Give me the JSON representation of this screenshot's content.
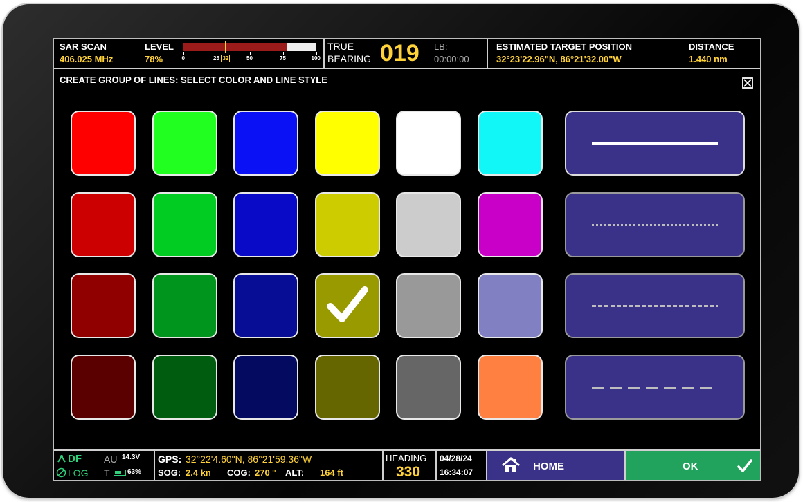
{
  "header": {
    "sar_label": "SAR SCAN",
    "sar_freq": "406.025 MHz",
    "level_label": "LEVEL",
    "level_value_text": "78%",
    "level_fraction": 0.78,
    "level_marker_value": 32,
    "level_ticks": [
      "0",
      "25",
      "32",
      "50",
      "75",
      "100"
    ],
    "bearing_label_top": "TRUE",
    "bearing_label_bottom": "BEARING",
    "bearing_value": "019",
    "lb_label": "LB:",
    "lb_time": "00:00:00",
    "target_label": "ESTIMATED TARGET POSITION",
    "target_value": "32°23'22.96\"N,  86°21'32.00\"W",
    "distance_label": "DISTANCE",
    "distance_value": "1.440 nm"
  },
  "dialog": {
    "title": "CREATE GROUP OF LINES: SELECT COLOR AND LINE STYLE",
    "close_icon": "close-x-icon"
  },
  "colors": [
    [
      "#ff0000",
      "#21ff21",
      "#0a12f5",
      "#ffff00",
      "#ffffff",
      "#11f7f7"
    ],
    [
      "#cc0000",
      "#00cc22",
      "#0909c8",
      "#cccc00",
      "#cccccc",
      "#c800c8"
    ],
    [
      "#900000",
      "#00961e",
      "#080d96",
      "#999900",
      "#999999",
      "#8080c2"
    ],
    [
      "#5a0000",
      "#005c0f",
      "#050a61",
      "#666600",
      "#666666",
      "#ff8040"
    ]
  ],
  "selected_color": {
    "row": 2,
    "col": 3
  },
  "selected_icon": "checkmark-icon",
  "line_styles": [
    {
      "name": "solid",
      "color": "#ffffff"
    },
    {
      "name": "dotted",
      "color": "#bdbdbd"
    },
    {
      "name": "dense-dashed",
      "color": "#bdbdbd"
    },
    {
      "name": "long-dashed",
      "color": "#bdbdbd"
    }
  ],
  "footer": {
    "df_label": "DF",
    "log_label": "LOG",
    "au_label": "AU",
    "voltage": "14.3V",
    "t_label": "T",
    "battery_pct": "63%",
    "battery_fraction": 0.63,
    "gps_label": "GPS:",
    "gps_value": "32°22'4.60\"N,  86°21'59.36\"W",
    "sog_label": "SOG:",
    "sog_value": "2.4 kn",
    "cog_label": "COG:",
    "cog_value": "270 °",
    "alt_label": "ALT:",
    "alt_value": "164 ft",
    "heading_label": "HEADING",
    "heading_value": "330",
    "date": "04/28/24",
    "time": "16:34:07",
    "home_label": "HOME",
    "home_icon": "home-icon",
    "ok_label": "OK",
    "ok_icon": "checkmark-icon",
    "accent_green": "#2fd17a",
    "accent_yellow": "#ffd23a"
  }
}
